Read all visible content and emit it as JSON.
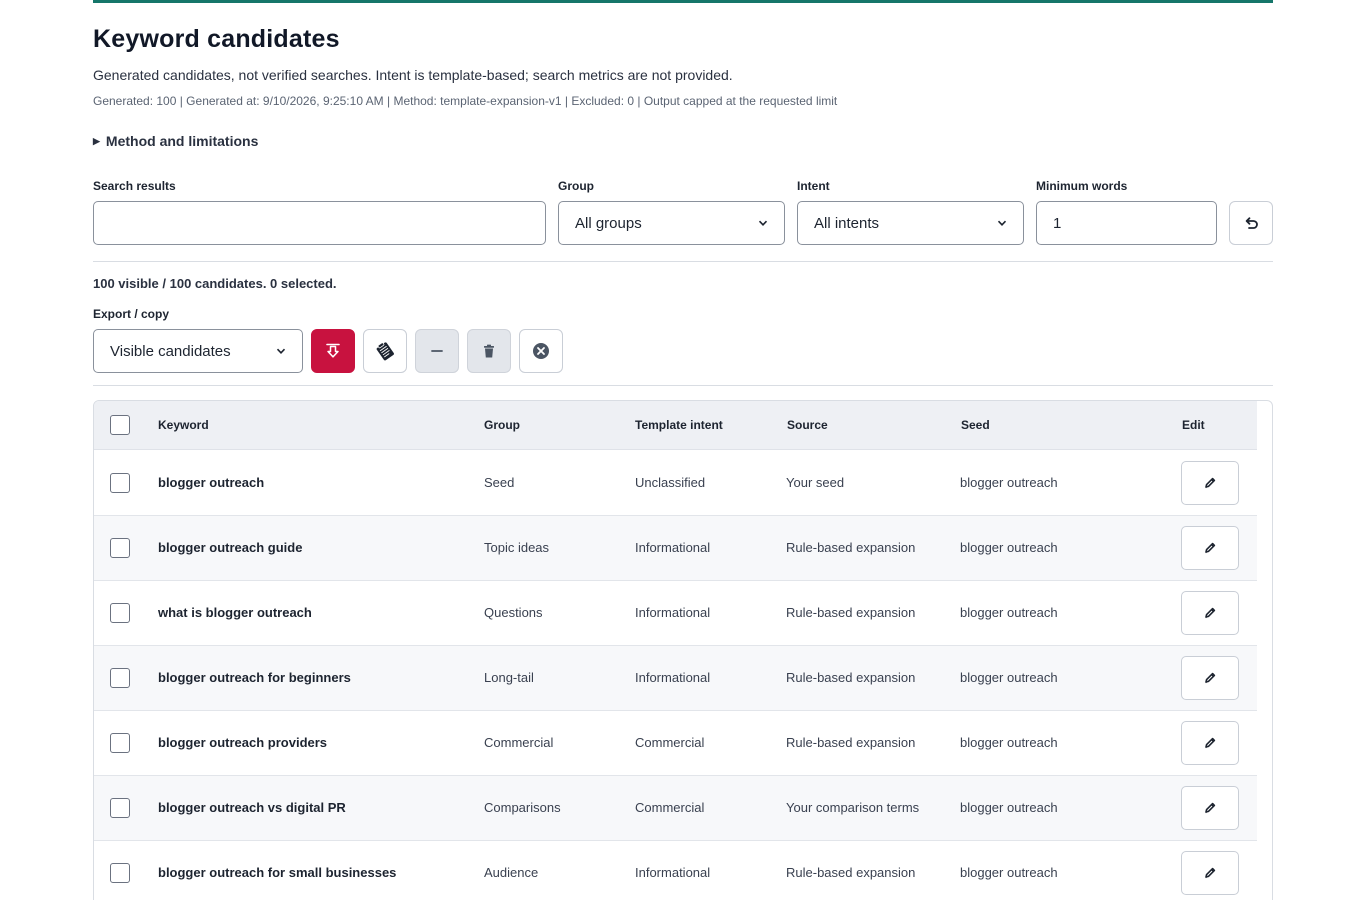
{
  "page": {
    "title": "Keyword candidates",
    "subtitle": "Generated candidates, not verified searches. Intent is template-based; search metrics are not provided.",
    "meta": "Generated: 100 | Generated at: 9/10/2026, 9:25:10 AM | Method: template-expansion-v1 | Excluded: 0 | Output capped at the requested limit",
    "details_label": "Method and limitations",
    "accent_color": "#15766a"
  },
  "filters": {
    "search_label": "Search results",
    "search_value": "",
    "group_label": "Group",
    "group_value": "All groups",
    "intent_label": "Intent",
    "intent_value": "All intents",
    "min_words_label": "Minimum words",
    "min_words_value": "1",
    "reset_icon": "undo-icon"
  },
  "status": {
    "count_text": "100 visible / 100 candidates. 0 selected."
  },
  "export": {
    "label": "Export / copy",
    "scope_value": "Visible candidates",
    "download_color": "#c8123f",
    "icons": [
      "download-icon",
      "clipboard-icon",
      "minus-icon",
      "trash-icon",
      "close-circle-icon"
    ]
  },
  "table": {
    "headers": {
      "keyword": "Keyword",
      "group": "Group",
      "intent": "Template intent",
      "source": "Source",
      "seed": "Seed",
      "edit": "Edit"
    },
    "rows": [
      {
        "keyword": "blogger outreach",
        "group": "Seed",
        "intent": "Unclassified",
        "source": "Your seed",
        "seed": "blogger outreach"
      },
      {
        "keyword": "blogger outreach guide",
        "group": "Topic ideas",
        "intent": "Informational",
        "source": "Rule-based expansion",
        "seed": "blogger outreach"
      },
      {
        "keyword": "what is blogger outreach",
        "group": "Questions",
        "intent": "Informational",
        "source": "Rule-based expansion",
        "seed": "blogger outreach"
      },
      {
        "keyword": "blogger outreach for beginners",
        "group": "Long-tail",
        "intent": "Informational",
        "source": "Rule-based expansion",
        "seed": "blogger outreach"
      },
      {
        "keyword": "blogger outreach providers",
        "group": "Commercial",
        "intent": "Commercial",
        "source": "Rule-based expansion",
        "seed": "blogger outreach"
      },
      {
        "keyword": "blogger outreach vs digital PR",
        "group": "Comparisons",
        "intent": "Commercial",
        "source": "Your comparison terms",
        "seed": "blogger outreach"
      },
      {
        "keyword": "blogger outreach for small businesses",
        "group": "Audience",
        "intent": "Informational",
        "source": "Rule-based expansion",
        "seed": "blogger outreach"
      }
    ]
  }
}
